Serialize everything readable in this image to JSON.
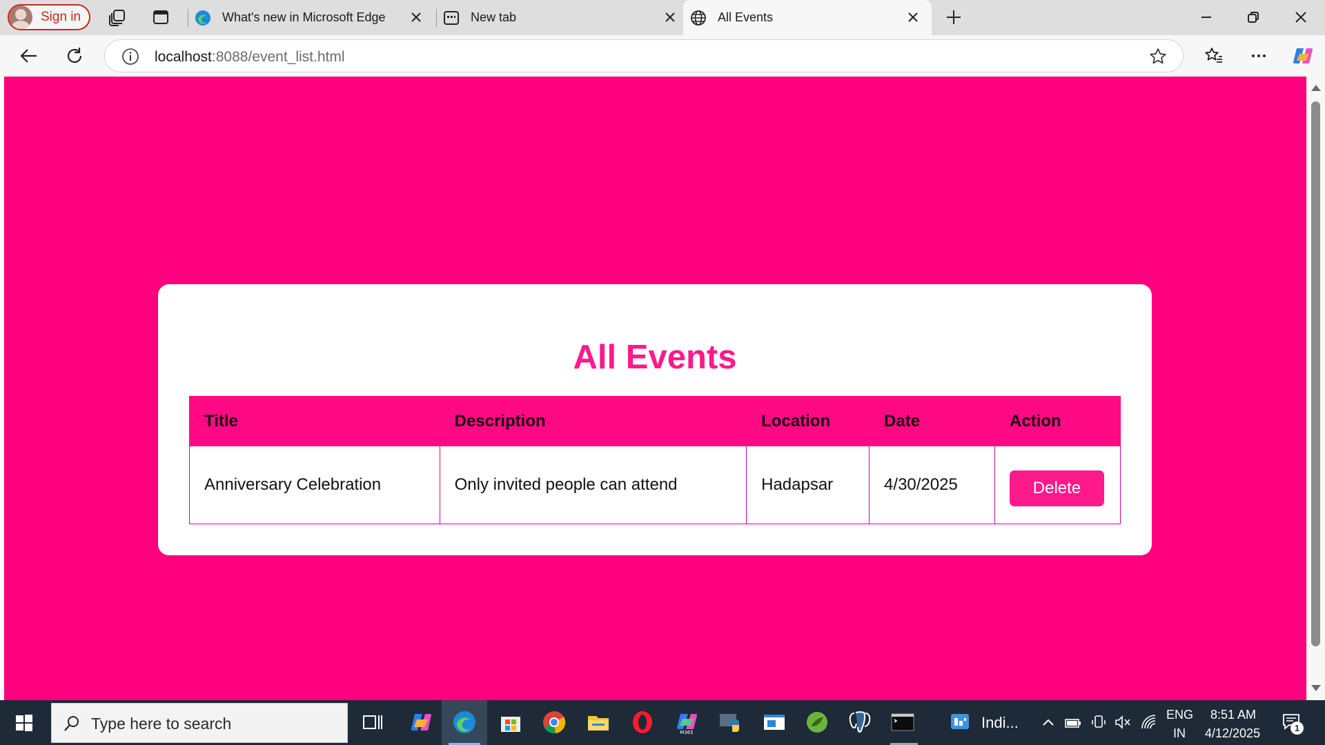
{
  "browser": {
    "sign_in_label": "Sign in",
    "tabs": [
      {
        "title": "What's new in Microsoft Edge",
        "icon": "edge-icon"
      },
      {
        "title": "New tab",
        "icon": "new-tab-icon"
      },
      {
        "title": "All Events",
        "icon": "globe-icon",
        "active": true
      }
    ],
    "address": {
      "host": "localhost",
      "rest": ":8088/event_list.html"
    }
  },
  "page": {
    "heading": "All Events",
    "background_color": "#ff007f",
    "accent_color": "#ff1a8c",
    "table": {
      "columns": [
        "Title",
        "Description",
        "Location",
        "Date",
        "Action"
      ],
      "rows": [
        {
          "title": "Anniversary Celebration",
          "description": "Only invited people can attend",
          "location": "Hadapsar",
          "date": "4/30/2025",
          "action_label": "Delete"
        }
      ]
    }
  },
  "taskbar": {
    "search_placeholder": "Type here to search",
    "pinned_window_label": "Indi...",
    "language": "ENG",
    "region": "IN",
    "time": "8:51 AM",
    "date": "4/12/2025",
    "notification_count": "1"
  }
}
